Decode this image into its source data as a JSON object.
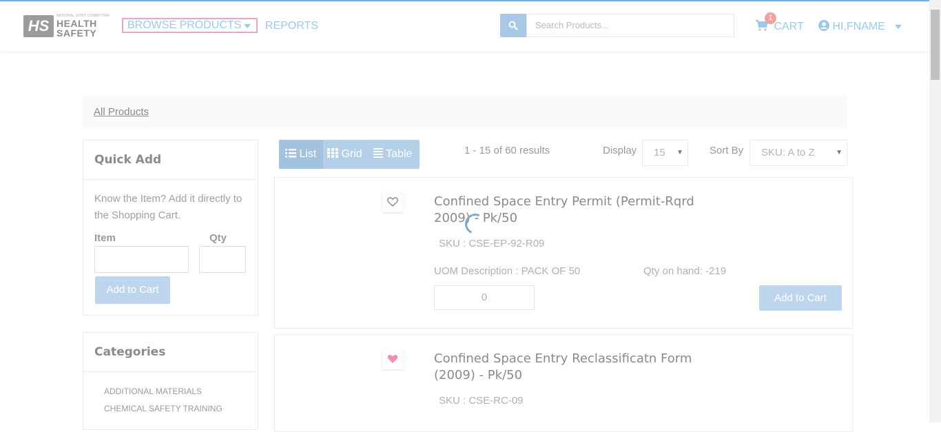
{
  "header": {
    "logo": {
      "tiny_text": "NATIONAL JOINT COMMITTEE",
      "line1": "HEALTH",
      "line2": "SAFETY",
      "mark": "HS"
    },
    "nav": {
      "browse_label": "BROWSE PRODUCTS",
      "reports_label": "REPORTS"
    },
    "search": {
      "placeholder": "Search Products..."
    },
    "cart": {
      "label": "CART",
      "count": "1"
    },
    "user": {
      "label": "HI,FNAME"
    }
  },
  "breadcrumb": {
    "all_products": "All Products"
  },
  "quick_add": {
    "title": "Quick Add",
    "description": "Know the Item? Add it directly to the Shopping Cart.",
    "item_label": "Item",
    "qty_label": "Qty",
    "button_label": "Add to Cart"
  },
  "categories": {
    "title": "Categories",
    "items": [
      "ADDITIONAL MATERIALS",
      "CHEMICAL SAFETY TRAINING"
    ]
  },
  "toolbar": {
    "views": [
      "List",
      "Grid",
      "Table"
    ],
    "results_text": "1 - 15 of 60 results",
    "display_label": "Display",
    "display_value": "15",
    "sort_label": "Sort By",
    "sort_value": "SKU: A to Z"
  },
  "products": [
    {
      "name": "Confined Space Entry Permit (Permit-Rqrd 2009) - Pk/50",
      "sku": "SKU : CSE-EP-92-R09",
      "uom": "UOM Description : PACK OF 50",
      "qty_on_hand": "Qty on hand: -219",
      "qty_value": "0",
      "button_label": "Add to Cart",
      "favorited": false
    },
    {
      "name": "Confined Space Entry Reclassificatn Form (2009) - Pk/50",
      "sku": "SKU : CSE-RC-09",
      "favorited": true
    }
  ],
  "colors": {
    "accent": "#9cc9ea",
    "button": "#bdd6ee",
    "heart_active": "#f08fb0",
    "badge": "#f2a0a0"
  }
}
